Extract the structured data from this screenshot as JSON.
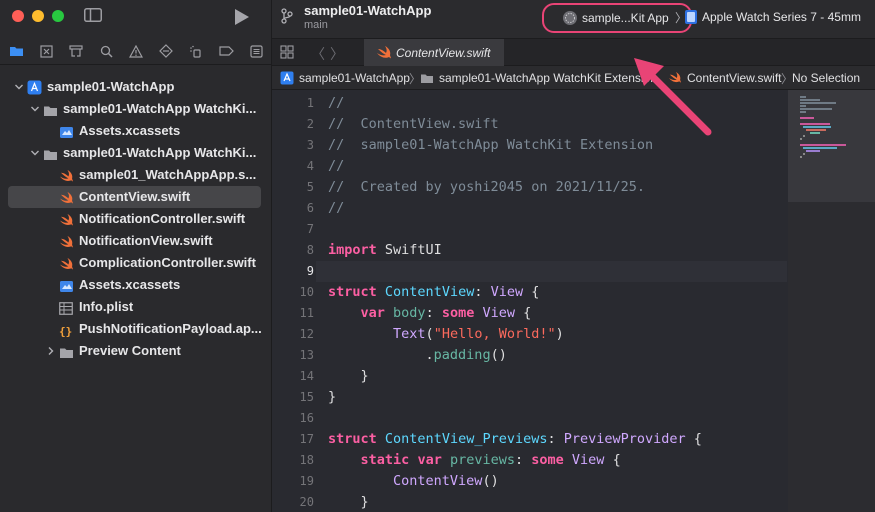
{
  "window": {
    "traffic_lights": [
      "#fe5f57",
      "#febc2e",
      "#28c840"
    ]
  },
  "sidebar": {
    "nav_tabs": [
      "folder-icon",
      "xmark-square-icon",
      "hierarchy-icon",
      "search-icon",
      "warning-icon",
      "diamond-icon",
      "spray-icon",
      "tag-icon",
      "list-icon"
    ],
    "tree": [
      {
        "label": "sample01-WatchApp",
        "icon": "xcodeproj-icon",
        "disclosure": "open",
        "selected": false
      },
      {
        "label": "sample01-WatchApp WatchKi...",
        "icon": "folder-icon",
        "disclosure": "open",
        "selected": false
      },
      {
        "label": "Assets.xcassets",
        "icon": "assets-icon",
        "disclosure": "",
        "selected": false
      },
      {
        "label": "sample01-WatchApp WatchKi...",
        "icon": "folder-icon",
        "disclosure": "open",
        "selected": false
      },
      {
        "label": "sample01_WatchAppApp.s...",
        "icon": "swift-icon",
        "disclosure": "",
        "selected": false
      },
      {
        "label": "ContentView.swift",
        "icon": "swift-icon",
        "disclosure": "",
        "selected": true
      },
      {
        "label": "NotificationController.swift",
        "icon": "swift-icon",
        "disclosure": "",
        "selected": false
      },
      {
        "label": "NotificationView.swift",
        "icon": "swift-icon",
        "disclosure": "",
        "selected": false
      },
      {
        "label": "ComplicationController.swift",
        "icon": "swift-icon",
        "disclosure": "",
        "selected": false
      },
      {
        "label": "Assets.xcassets",
        "icon": "assets-icon",
        "disclosure": "",
        "selected": false
      },
      {
        "label": "Info.plist",
        "icon": "plist-icon",
        "disclosure": "",
        "selected": false
      },
      {
        "label": "PushNotificationPayload.ap...",
        "icon": "json-icon",
        "disclosure": "",
        "selected": false
      },
      {
        "label": "Preview Content",
        "icon": "folder-icon",
        "disclosure": "closed",
        "selected": false
      }
    ]
  },
  "toolbar": {
    "project_name": "sample01-WatchApp",
    "branch": "main",
    "scheme": "sample...Kit App",
    "device": "Apple Watch Series 7 - 45mm"
  },
  "tabbar": {
    "file_tab": "ContentView.swift"
  },
  "jumpbar": {
    "project": "sample01-WatchApp",
    "group": "sample01-WatchApp WatchKit Extension",
    "file": "ContentView.swift",
    "symbol": "No Selection"
  },
  "editor": {
    "current_line": 9,
    "line_numbers": [
      "1",
      "2",
      "3",
      "4",
      "5",
      "6",
      "7",
      "8",
      "9",
      "10",
      "11",
      "12",
      "13",
      "14",
      "15",
      "16",
      "17",
      "18",
      "19",
      "20"
    ],
    "lines": [
      [
        [
          "//",
          "cmt"
        ]
      ],
      [
        [
          "//  ContentView.swift",
          "cmt"
        ]
      ],
      [
        [
          "//  sample01-WatchApp WatchKit Extension",
          "cmt"
        ]
      ],
      [
        [
          "//",
          "cmt"
        ]
      ],
      [
        [
          "//  Created by yoshi2045 on 2021/11/25.",
          "cmt"
        ]
      ],
      [
        [
          "//",
          "cmt"
        ]
      ],
      [],
      [
        [
          "import",
          "kw"
        ],
        [
          " SwiftUI",
          "plain"
        ]
      ],
      [],
      [
        [
          "struct",
          "kw"
        ],
        [
          " ",
          "plain"
        ],
        [
          "ContentView",
          "type"
        ],
        [
          ": ",
          "plain"
        ],
        [
          "View",
          "type2"
        ],
        [
          " {",
          "plain"
        ]
      ],
      [
        [
          "    ",
          "plain"
        ],
        [
          "var",
          "kw"
        ],
        [
          " ",
          "plain"
        ],
        [
          "body",
          "prop"
        ],
        [
          ": ",
          "plain"
        ],
        [
          "some",
          "kw"
        ],
        [
          " ",
          "plain"
        ],
        [
          "View",
          "type2"
        ],
        [
          " {",
          "plain"
        ]
      ],
      [
        [
          "        ",
          "plain"
        ],
        [
          "Text",
          "type2"
        ],
        [
          "(",
          "plain"
        ],
        [
          "\"Hello, World!\"",
          "str"
        ],
        [
          ")",
          "plain"
        ]
      ],
      [
        [
          "            .",
          "plain"
        ],
        [
          "padding",
          "prop"
        ],
        [
          "()",
          "plain"
        ]
      ],
      [
        [
          "    }",
          "plain"
        ]
      ],
      [
        [
          "}",
          "plain"
        ]
      ],
      [],
      [
        [
          "struct",
          "kw"
        ],
        [
          " ",
          "plain"
        ],
        [
          "ContentView_Previews",
          "type"
        ],
        [
          ": ",
          "plain"
        ],
        [
          "PreviewProvider",
          "type2"
        ],
        [
          " {",
          "plain"
        ]
      ],
      [
        [
          "    ",
          "plain"
        ],
        [
          "static",
          "kw"
        ],
        [
          " ",
          "plain"
        ],
        [
          "var",
          "kw"
        ],
        [
          " ",
          "plain"
        ],
        [
          "previews",
          "prop"
        ],
        [
          ": ",
          "plain"
        ],
        [
          "some",
          "kw"
        ],
        [
          " ",
          "plain"
        ],
        [
          "View",
          "type2"
        ],
        [
          " {",
          "plain"
        ]
      ],
      [
        [
          "        ",
          "plain"
        ],
        [
          "ContentView",
          "type2"
        ],
        [
          "()",
          "plain"
        ]
      ],
      [
        [
          "    }",
          "plain"
        ]
      ]
    ]
  },
  "annotation": {
    "color": "#e94476"
  }
}
